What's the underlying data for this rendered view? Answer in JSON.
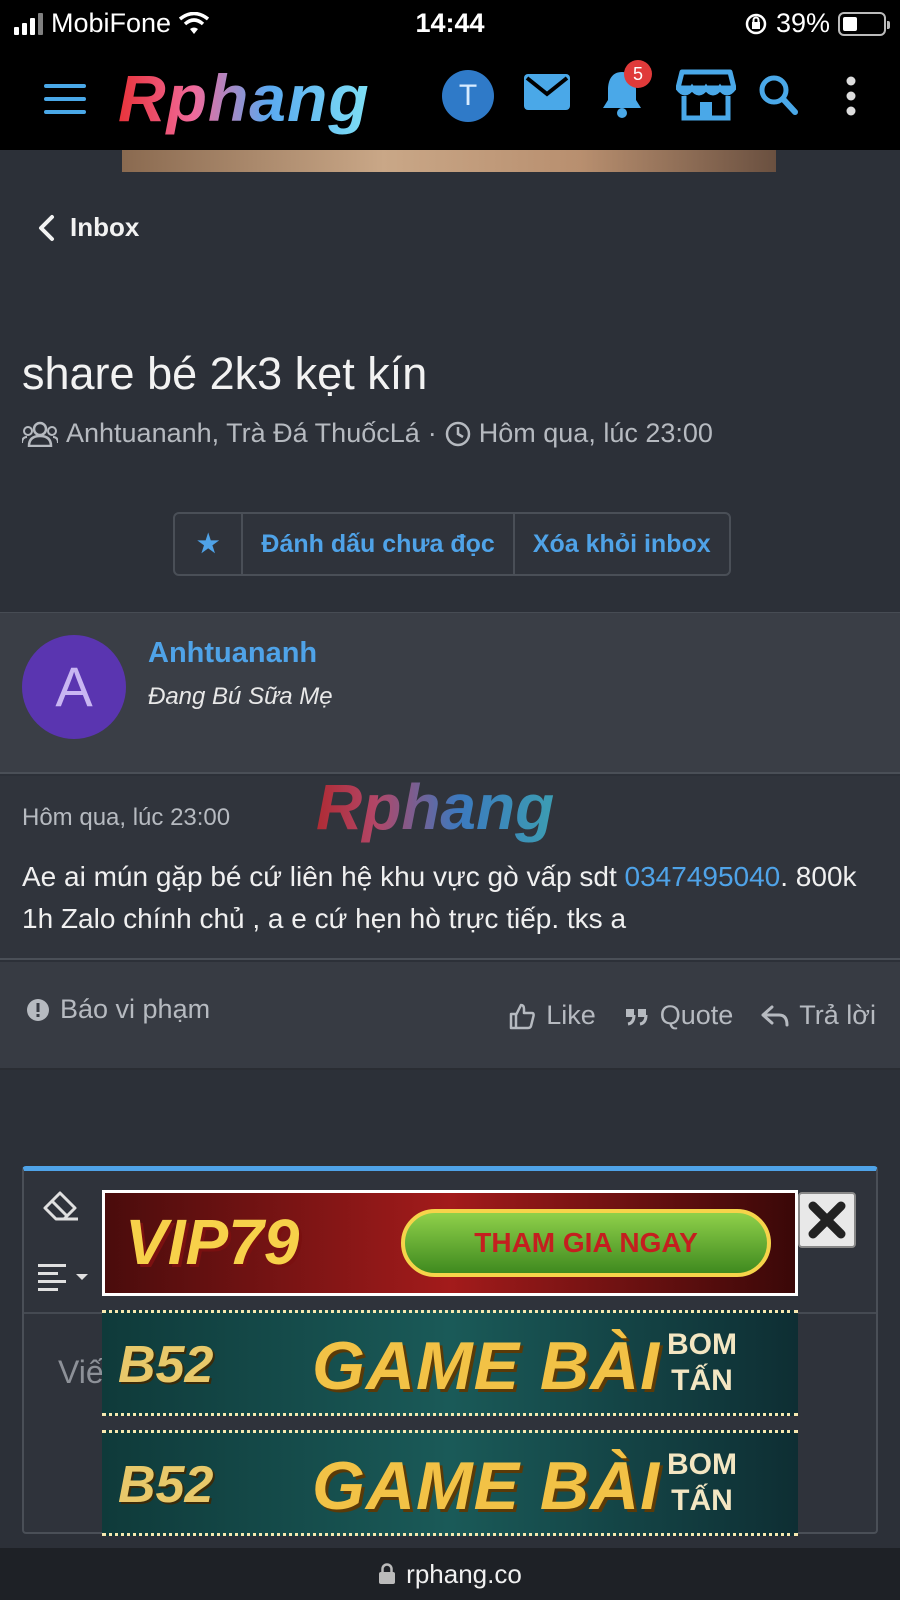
{
  "status_bar": {
    "carrier": "MobiFone",
    "time": "14:44",
    "battery": "39%"
  },
  "header": {
    "logo": "Rphang",
    "avatar_letter": "T",
    "notification_count": "5"
  },
  "back": {
    "label": "Inbox"
  },
  "conversation": {
    "title": "share bé 2k3 kẹt kín",
    "participants": "Anhtuananh, Trà Đá ThuốcLá",
    "separator": "·",
    "time": "Hôm qua, lúc 23:00"
  },
  "actions_bar": {
    "mark_unread": "Đánh dấu chưa đọc",
    "remove_inbox": "Xóa khỏi inbox"
  },
  "message": {
    "author": "Anhtuananh",
    "author_initial": "A",
    "user_title": "Đang Bú Sữa Mẹ",
    "watermark": "Rphang",
    "time": "Hôm qua, lúc 23:00",
    "text_before": "Ae ai mún gặp bé cứ liên hệ khu vực gò vấp sdt ",
    "phone": "0347495040",
    "text_after": ". 800k 1h Zalo chính chủ , a e cứ hẹn hò trực tiếp. tks a"
  },
  "message_actions": {
    "report": "Báo vi phạm",
    "like": "Like",
    "quote": "Quote",
    "reply": "Trả lời"
  },
  "editor": {
    "placeholder_partial": "Viế"
  },
  "ads": {
    "vip_logo": "VIP79",
    "vip_cta": "THAM GIA NGAY",
    "b52_logo": "B52",
    "b52_text": "GAME BÀI",
    "b52_sub_1": "BOM",
    "b52_sub_2": "TẤN"
  },
  "url_bar": {
    "domain": "rphang.co"
  },
  "colors": {
    "accent": "#4fa3e8",
    "background": "#2c3038",
    "badge": "#e03a3a",
    "avatar_a": "#5a35b0"
  }
}
